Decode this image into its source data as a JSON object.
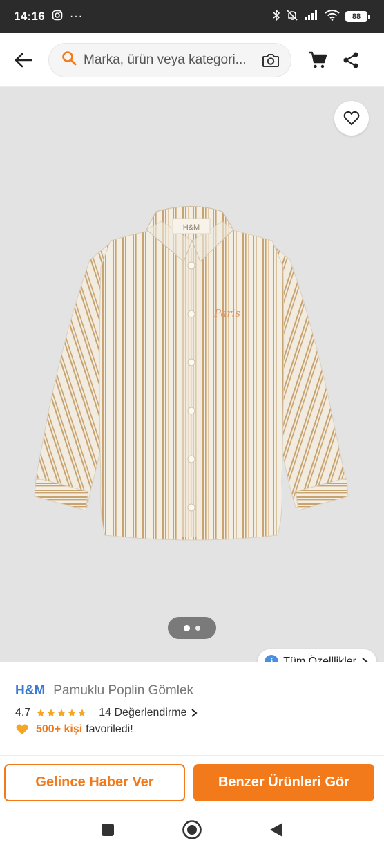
{
  "status_bar": {
    "time": "14:16",
    "battery": "88"
  },
  "header": {
    "search_placeholder": "Marka, ürün veya kategori..."
  },
  "gallery": {
    "image_brand": "H&M",
    "image_script": "Paris",
    "specs_label": "Tüm Özelllikler",
    "page_count": 2,
    "active_page": 1
  },
  "product": {
    "brand": "H&M",
    "name": "Pamuklu Poplin Gömlek",
    "rating": "4.7",
    "rating_value": 4.7,
    "reviews": "14 Değerlendirme",
    "fav_count": "500+ kişi",
    "fav_suffix": "favoriledi!"
  },
  "actions": {
    "notify_label": "Gelince Haber Ver",
    "similar_label": "Benzer Ürünleri Gör"
  },
  "colors": {
    "accent": "#f27a1a",
    "brand_blue": "#3a7bd5",
    "star": "#f5a623"
  }
}
